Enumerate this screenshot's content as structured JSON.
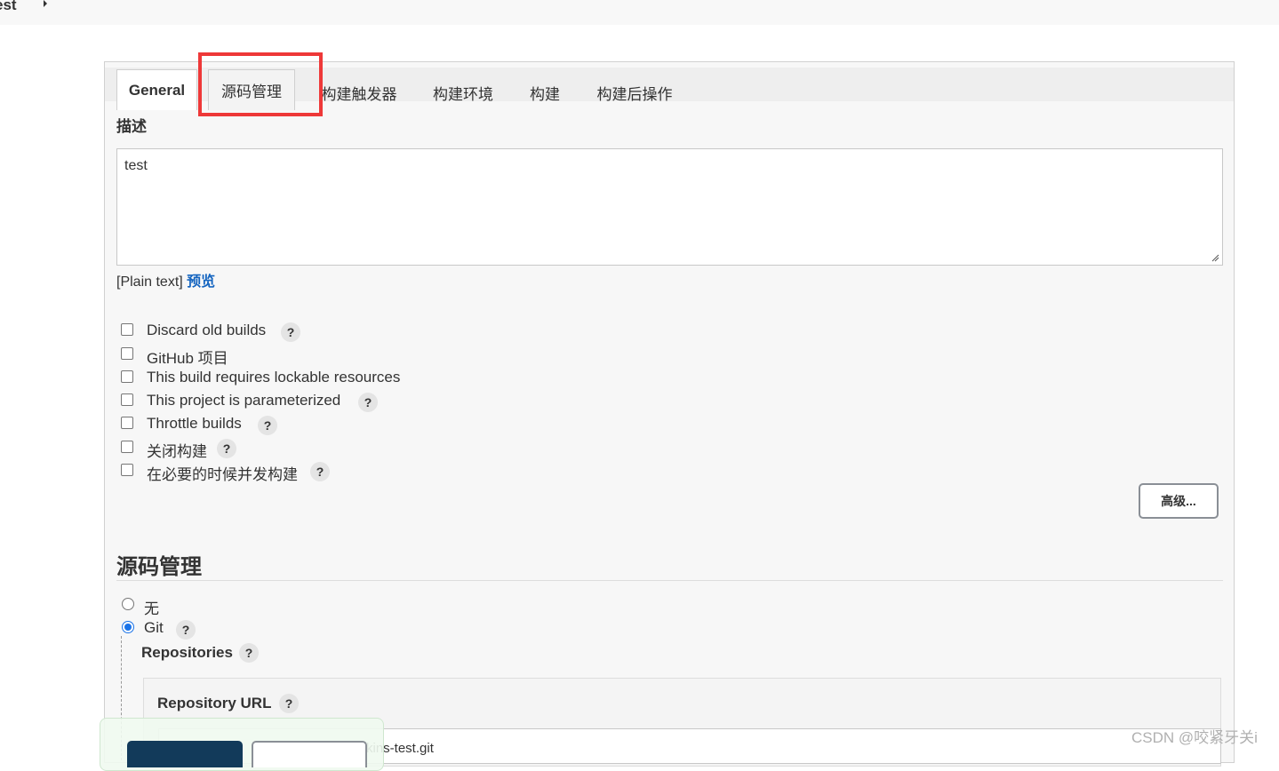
{
  "breadcrumb": {
    "item": "est"
  },
  "tabs": [
    {
      "label": "General"
    },
    {
      "label": "源码管理"
    },
    {
      "label": "构建触发器"
    },
    {
      "label": "构建环境"
    },
    {
      "label": "构建"
    },
    {
      "label": "构建后操作"
    }
  ],
  "general": {
    "description_label": "描述",
    "description_value": "test",
    "plain_text": "[Plain text]",
    "preview_link": "预览",
    "options": [
      {
        "label": "Discard old builds",
        "help": "?"
      },
      {
        "label": "GitHub 项目"
      },
      {
        "label": "This build requires lockable resources"
      },
      {
        "label": "This project is parameterized",
        "help": "?"
      },
      {
        "label": "Throttle builds",
        "help": "?"
      },
      {
        "label": "关闭构建",
        "help": "?"
      },
      {
        "label": "在必要的时候并发构建",
        "help": "?"
      }
    ],
    "advanced_button": "高级..."
  },
  "scm": {
    "title": "源码管理",
    "options": [
      {
        "label": "无",
        "selected": false
      },
      {
        "label": "Git",
        "selected": true,
        "help": "?"
      }
    ],
    "repositories_label": "Repositories",
    "repositories_help": "?",
    "repository_url_label": "Repository URL",
    "repository_url_help": "?",
    "repository_url_value_partial": "kins-test.git"
  },
  "watermark": "CSDN @咬紧牙关i",
  "colors": {
    "highlight": "#ee3838",
    "link": "#1565c0",
    "save_button": "#123a5a",
    "radio_selected": "#1a73e8"
  }
}
